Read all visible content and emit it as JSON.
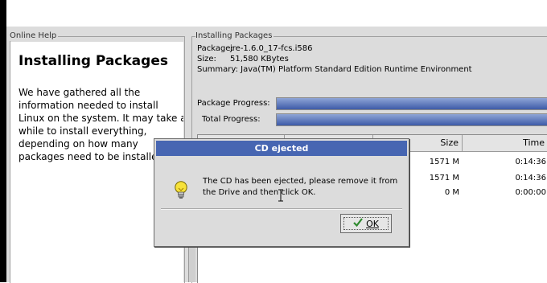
{
  "help": {
    "legend": "Online Help",
    "title": "Installing Packages",
    "body": "We have gathered all the\ninformation needed to install\nLinux on the system. It may take a\nwhile to install everything,\ndepending on how many\npackages need to be installed."
  },
  "install": {
    "legend": "Installing Packages",
    "package_key": "Package:",
    "package_value": "jre-1.6.0_17-fcs.i586",
    "size_key": "Size:",
    "size_value": "51,580 KBytes",
    "summary_key": "Summary:",
    "summary_value": "Java(TM) Platform Standard Edition Runtime Environment",
    "package_progress_label": "Package Progress:",
    "total_progress_label": "Total Progress:",
    "package_progress": 1.0,
    "total_progress": 1.0
  },
  "table": {
    "columns": [
      "Size",
      "Time"
    ],
    "rows": [
      {
        "size": "1571 M",
        "time": "0:14:36"
      },
      {
        "size": "1571 M",
        "time": "0:14:36"
      },
      {
        "size": "0 M",
        "time": "0:00:00"
      }
    ]
  },
  "dialog": {
    "title": "CD ejected",
    "message": "The CD has been ejected, please remove it from\nthe Drive and then click OK.",
    "ok_label": "OK",
    "icon": "lightbulb-icon"
  },
  "colors": {
    "titlebar": "#4766b2",
    "progress": "#3d5ba8"
  }
}
